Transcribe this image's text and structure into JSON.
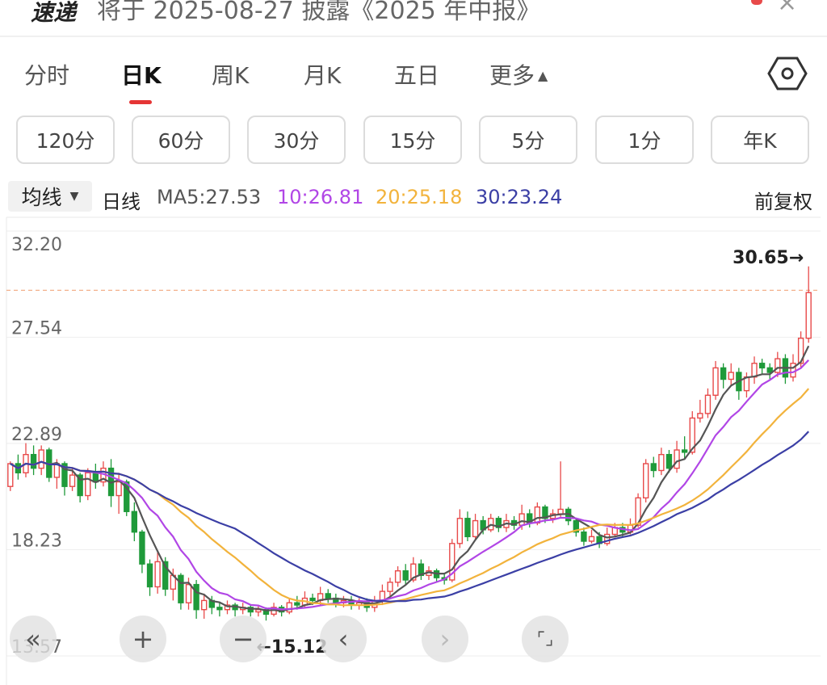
{
  "header": {
    "logo": "速递",
    "headline": "将于 2025-08-27 披露《2025 年中报》"
  },
  "tabs": [
    {
      "label": "分时",
      "active": false
    },
    {
      "label": "日K",
      "active": true
    },
    {
      "label": "周K",
      "active": false
    },
    {
      "label": "月K",
      "active": false
    },
    {
      "label": "五日",
      "active": false
    },
    {
      "label": "更多",
      "active": false
    }
  ],
  "intervals": [
    "120分",
    "60分",
    "30分",
    "15分",
    "5分",
    "1分",
    "年K"
  ],
  "ma_bar": {
    "select_label": "均线",
    "period_label": "日线",
    "ma5": "MA5:27.53",
    "ma10": "10:26.81",
    "ma20": "20:25.18",
    "ma30": "30:23.24",
    "adjust": "前复权"
  },
  "colors": {
    "up": "#e84a4a",
    "down": "#1f9a3a",
    "ma5": "#555555",
    "ma10": "#b146e6",
    "ma20": "#f2b33c",
    "ma30": "#3b3fa5",
    "active_tab": "#e53535"
  },
  "chart_data": {
    "type": "candlestick",
    "y_ticks": [
      32.2,
      27.54,
      22.89,
      18.23,
      13.57
    ],
    "y_tick_labels": [
      "32.20",
      "27.54",
      "22.89",
      "18.23",
      "13.57"
    ],
    "ylim": [
      13.57,
      32.2
    ],
    "max_label": "30.65→",
    "min_label": "←15.12",
    "reference_line": 29.6,
    "series_names": [
      "MA5",
      "MA10",
      "MA20",
      "MA30"
    ],
    "candles": [
      [
        21.0,
        22.0,
        20.8,
        22.1
      ],
      [
        22.0,
        21.6,
        21.3,
        22.4
      ],
      [
        21.6,
        22.4,
        21.4,
        22.9
      ],
      [
        22.4,
        21.8,
        21.5,
        22.8
      ],
      [
        21.8,
        22.6,
        21.5,
        22.8
      ],
      [
        22.6,
        21.4,
        21.2,
        22.7
      ],
      [
        21.4,
        22.0,
        20.9,
        22.2
      ],
      [
        22.0,
        21.0,
        20.6,
        22.1
      ],
      [
        21.0,
        21.5,
        20.8,
        21.8
      ],
      [
        21.5,
        20.6,
        20.3,
        21.6
      ],
      [
        20.6,
        21.6,
        20.4,
        21.8
      ],
      [
        21.6,
        21.2,
        20.9,
        22.0
      ],
      [
        21.2,
        21.8,
        21.0,
        22.1
      ],
      [
        21.8,
        20.6,
        20.1,
        22.2
      ],
      [
        20.6,
        21.2,
        19.8,
        21.6
      ],
      [
        21.2,
        19.9,
        19.7,
        21.3
      ],
      [
        19.9,
        19.0,
        18.6,
        20.3
      ],
      [
        19.0,
        17.6,
        17.2,
        19.1
      ],
      [
        17.6,
        16.6,
        16.2,
        17.8
      ],
      [
        16.6,
        17.7,
        16.3,
        18.2
      ],
      [
        17.7,
        16.5,
        16.2,
        17.9
      ],
      [
        16.5,
        17.1,
        16.0,
        17.4
      ],
      [
        17.1,
        15.9,
        15.6,
        17.2
      ],
      [
        15.9,
        16.7,
        15.6,
        17.0
      ],
      [
        16.7,
        15.6,
        15.2,
        16.9
      ],
      [
        15.6,
        16.0,
        15.2,
        16.3
      ],
      [
        16.0,
        15.7,
        15.4,
        16.2
      ],
      [
        15.7,
        15.6,
        15.3,
        15.9
      ],
      [
        15.6,
        15.8,
        15.4,
        16.0
      ],
      [
        15.8,
        15.6,
        15.3,
        15.9
      ],
      [
        15.6,
        15.7,
        15.4,
        15.9
      ],
      [
        15.7,
        15.5,
        15.3,
        15.8
      ],
      [
        15.5,
        15.6,
        15.3,
        15.8
      ],
      [
        15.6,
        15.4,
        15.12,
        15.7
      ],
      [
        15.4,
        15.7,
        15.3,
        15.9
      ],
      [
        15.7,
        15.5,
        15.3,
        15.8
      ],
      [
        15.5,
        15.9,
        15.4,
        16.1
      ],
      [
        15.9,
        15.8,
        15.6,
        16.2
      ],
      [
        15.8,
        16.1,
        15.7,
        16.4
      ],
      [
        16.1,
        16.0,
        15.8,
        16.3
      ],
      [
        16.0,
        16.3,
        15.8,
        16.6
      ],
      [
        16.3,
        16.1,
        15.9,
        16.5
      ],
      [
        16.1,
        15.9,
        15.7,
        16.3
      ],
      [
        15.9,
        16.0,
        15.7,
        16.2
      ],
      [
        16.0,
        15.8,
        15.6,
        16.2
      ],
      [
        15.8,
        15.9,
        15.6,
        16.1
      ],
      [
        15.9,
        15.7,
        15.5,
        16.1
      ],
      [
        15.7,
        16.0,
        15.5,
        16.2
      ],
      [
        16.0,
        16.4,
        15.8,
        16.7
      ],
      [
        16.4,
        16.8,
        16.2,
        17.0
      ],
      [
        16.8,
        17.3,
        16.6,
        17.5
      ],
      [
        17.3,
        16.9,
        16.7,
        17.6
      ],
      [
        16.9,
        17.6,
        16.8,
        17.9
      ],
      [
        17.6,
        17.1,
        16.9,
        17.8
      ],
      [
        17.1,
        17.3,
        16.9,
        17.5
      ],
      [
        17.3,
        17.0,
        16.8,
        17.4
      ],
      [
        17.0,
        16.9,
        16.7,
        17.2
      ],
      [
        16.9,
        18.5,
        16.8,
        18.7
      ],
      [
        18.5,
        19.6,
        18.3,
        20.0
      ],
      [
        19.6,
        18.8,
        18.6,
        19.9
      ],
      [
        18.8,
        19.5,
        18.7,
        19.8
      ],
      [
        19.5,
        19.1,
        18.9,
        19.7
      ],
      [
        19.1,
        19.6,
        19.0,
        19.8
      ],
      [
        19.6,
        19.2,
        19.0,
        19.7
      ],
      [
        19.2,
        19.5,
        19.0,
        19.8
      ],
      [
        19.5,
        19.3,
        19.1,
        19.7
      ],
      [
        19.3,
        19.8,
        19.1,
        20.2
      ],
      [
        19.8,
        19.4,
        19.2,
        20.0
      ],
      [
        19.4,
        20.1,
        19.3,
        20.3
      ],
      [
        20.1,
        19.6,
        19.4,
        20.2
      ],
      [
        19.6,
        19.8,
        19.4,
        20.0
      ],
      [
        19.8,
        20.0,
        19.6,
        22.1
      ],
      [
        20.0,
        19.5,
        19.3,
        20.1
      ],
      [
        19.5,
        19.0,
        18.8,
        19.6
      ],
      [
        19.0,
        18.6,
        18.4,
        19.2
      ],
      [
        18.6,
        18.8,
        18.5,
        19.1
      ],
      [
        18.8,
        18.5,
        18.3,
        19.0
      ],
      [
        18.5,
        18.9,
        18.4,
        19.2
      ],
      [
        18.9,
        19.2,
        18.8,
        19.4
      ],
      [
        19.2,
        19.0,
        18.8,
        19.4
      ],
      [
        19.0,
        19.3,
        18.9,
        19.6
      ],
      [
        19.3,
        20.5,
        19.2,
        20.7
      ],
      [
        20.5,
        22.0,
        20.3,
        22.2
      ],
      [
        22.0,
        21.7,
        21.4,
        22.3
      ],
      [
        21.7,
        22.4,
        21.5,
        22.7
      ],
      [
        22.4,
        21.8,
        21.6,
        22.6
      ],
      [
        21.8,
        22.6,
        21.6,
        23.0
      ],
      [
        22.6,
        22.5,
        22.2,
        23.2
      ],
      [
        22.5,
        24.0,
        22.4,
        24.3
      ],
      [
        24.0,
        24.2,
        23.8,
        24.8
      ],
      [
        24.2,
        25.0,
        24.0,
        25.3
      ],
      [
        25.0,
        26.2,
        24.8,
        26.5
      ],
      [
        26.2,
        25.7,
        25.3,
        26.4
      ],
      [
        25.7,
        26.0,
        25.4,
        26.4
      ],
      [
        26.0,
        25.2,
        24.8,
        26.2
      ],
      [
        25.2,
        25.8,
        24.9,
        26.0
      ],
      [
        25.8,
        26.4,
        25.5,
        26.7
      ],
      [
        26.4,
        26.2,
        25.9,
        26.6
      ],
      [
        26.2,
        26.0,
        25.7,
        26.4
      ],
      [
        26.0,
        26.6,
        25.8,
        26.9
      ],
      [
        26.6,
        25.8,
        25.5,
        26.8
      ],
      [
        25.8,
        26.4,
        25.6,
        26.8
      ],
      [
        26.4,
        27.5,
        26.2,
        27.8
      ],
      [
        27.5,
        29.5,
        27.3,
        30.65
      ]
    ]
  },
  "controls": [
    "«",
    "+",
    "−",
    "‹",
    "›",
    "⌜⌟"
  ]
}
